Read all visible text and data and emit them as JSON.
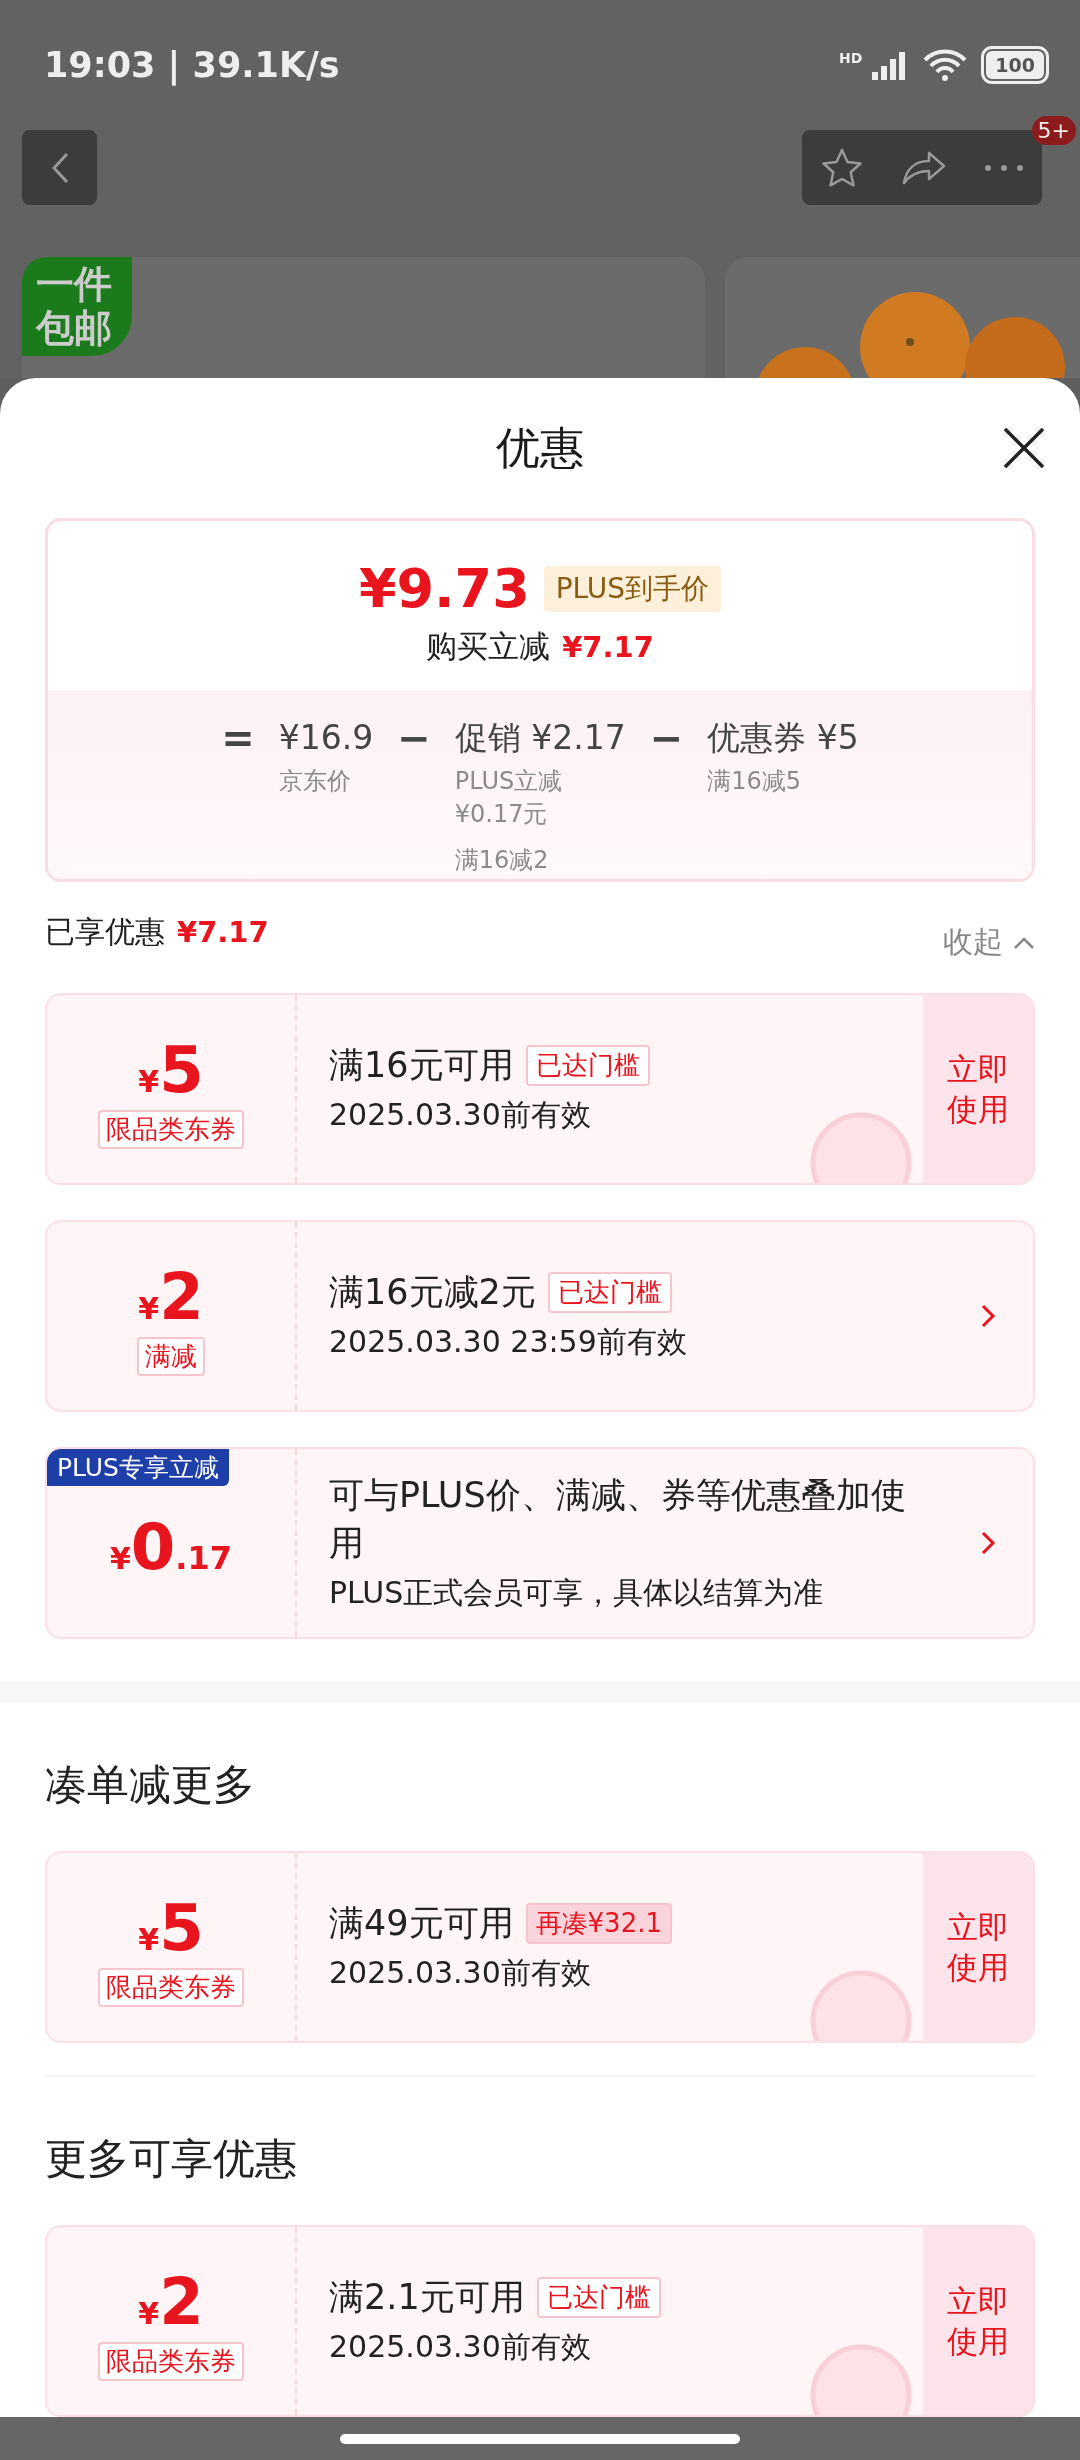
{
  "status_bar": {
    "time": "19:03 | 39.1K/s",
    "network": "HD",
    "battery": "100"
  },
  "product_nav": {
    "badge": "5+",
    "promo_tag": "一件包邮"
  },
  "sheet": {
    "title": "优惠"
  },
  "summary": {
    "price": "¥9.73",
    "price_label": "PLUS到手价",
    "saving_label": "购买立减",
    "saving": "¥7.17",
    "equals": "=",
    "terms": [
      {
        "value": "¥16.9",
        "notes": [
          "京东价"
        ]
      },
      {
        "operator": "−",
        "value": "促销 ¥2.17",
        "notes": [
          "PLUS立减¥0.17元",
          "满16减2"
        ]
      },
      {
        "operator": "−",
        "value": "优惠券 ¥5",
        "notes": [
          "满16减5"
        ]
      }
    ]
  },
  "enjoyed": {
    "label": "已享优惠",
    "amount": "¥7.17",
    "toggle": "收起",
    "expanded": true
  },
  "coupons": [
    {
      "kind": "ticket",
      "currency": "¥",
      "amount": "5",
      "tag": "限品类东券",
      "title": "满16元可用",
      "badge": {
        "kind": "reached",
        "text": "已达门槛"
      },
      "validity": "2025.03.30前有效",
      "action": "立即使用"
    },
    {
      "kind": "promo",
      "currency": "¥",
      "amount": "2",
      "tag": "满减",
      "title": "满16元减2元",
      "badge": {
        "kind": "reached",
        "text": "已达门槛"
      },
      "validity": "2025.03.30 23:59前有效"
    },
    {
      "kind": "promo",
      "corner": "PLUS专享立减",
      "currency": "¥",
      "amount": "0",
      "fraction": ".17",
      "title": "可与PLUS价、满减、券等优惠叠加使用",
      "validity": "PLUS正式会员可享，具体以结算为准"
    }
  ],
  "sections": [
    {
      "heading": "凑单减更多",
      "coupons": [
        {
          "kind": "ticket",
          "currency": "¥",
          "amount": "5",
          "tag": "限品类东券",
          "title": "满49元可用",
          "badge": {
            "kind": "gap",
            "text": "再凑¥32.1"
          },
          "validity": "2025.03.30前有效",
          "action": "立即使用"
        }
      ]
    },
    {
      "heading": "更多可享优惠",
      "coupons": [
        {
          "kind": "ticket",
          "currency": "¥",
          "amount": "2",
          "tag": "限品类东券",
          "title": "满2.1元可用",
          "badge": {
            "kind": "reached",
            "text": "已达门槛"
          },
          "validity": "2025.03.30前有效",
          "action": "立即使用"
        }
      ]
    }
  ]
}
